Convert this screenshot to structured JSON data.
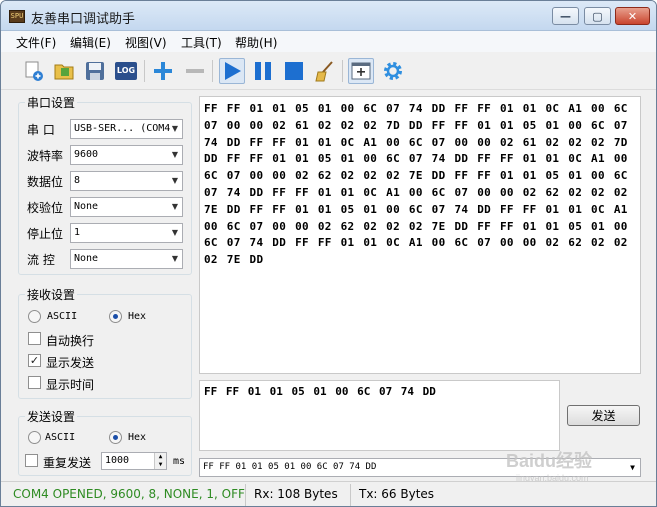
{
  "window": {
    "title": "友善串口调试助手",
    "icon_text": "SPU"
  },
  "titlebar_buttons": {
    "minimize": "—",
    "maximize": "▢",
    "close": "✕"
  },
  "menu": [
    "文件(F)",
    "编辑(E)",
    "视图(V)",
    "工具(T)",
    "帮助(H)"
  ],
  "toolbar": {
    "log_label": "LOG"
  },
  "serial_settings": {
    "title": "串口设置",
    "port_label": "串  口",
    "port_value": "USB-SER... (COM4",
    "baud_label": "波特率",
    "baud_value": "9600",
    "data_bits_label": "数据位",
    "data_bits_value": "8",
    "parity_label": "校验位",
    "parity_value": "None",
    "stop_bits_label": "停止位",
    "stop_bits_value": "1",
    "flow_label": "流  控",
    "flow_value": "None"
  },
  "receive_settings": {
    "title": "接收设置",
    "ascii_label": "ASCII",
    "hex_label": "Hex",
    "mode": "Hex",
    "auto_newline_label": "自动换行",
    "auto_newline_checked": false,
    "show_send_label": "显示发送",
    "show_send_checked": true,
    "show_time_label": "显示时间",
    "show_time_checked": false
  },
  "send_settings": {
    "title": "发送设置",
    "ascii_label": "ASCII",
    "hex_label": "Hex",
    "mode": "Hex",
    "repeat_label": "重复发送",
    "repeat_checked": false,
    "interval_value": "1000",
    "interval_unit": "ms"
  },
  "receive_text": "FF FF 01 01 05 01 00 6C 07 74 DD FF FF 01 01 0C A1 00 6C 07 00 00 02 61 02 02 02 7D DD FF FF 01 01 05 01 00 6C 07 74 DD FF FF 01 01 0C A1 00 6C 07 00 00 02 61 02 02 02 7D DD FF FF 01 01 05 01 00 6C 07 74 DD FF FF 01 01 0C A1 00 6C 07 00 00 02 62 02 02 02 7E DD FF FF 01 01 05 01 00 6C 07 74 DD FF FF 01 01 0C A1 00 6C 07 00 00 02 62 02 02 02 7E DD FF FF 01 01 05 01 00 6C 07 74 DD FF FF 01 01 0C A1 00 6C 07 00 00 02 62 02 02 02 7E DD FF FF 01 01 05 01 00 6C 07 74 DD FF FF 01 01 0C A1 00 6C 07 00 00 02 62 02 02 02 7E DD",
  "send_text": "FF FF 01 01 05 01 00 6C 07 74 DD",
  "send_button": "发送",
  "history_value": "FF FF 01 01 05 01 00 6C 07 74 DD",
  "status": {
    "connection": "COM4 OPENED, 9600, 8, NONE, 1, OFF",
    "rx": "Rx: 108 Bytes",
    "tx": "Tx: 66 Bytes",
    "connection_color": "#2e8b22"
  },
  "watermark": {
    "main": "Baidu经验",
    "sub": "jingyan.baidu.com"
  }
}
